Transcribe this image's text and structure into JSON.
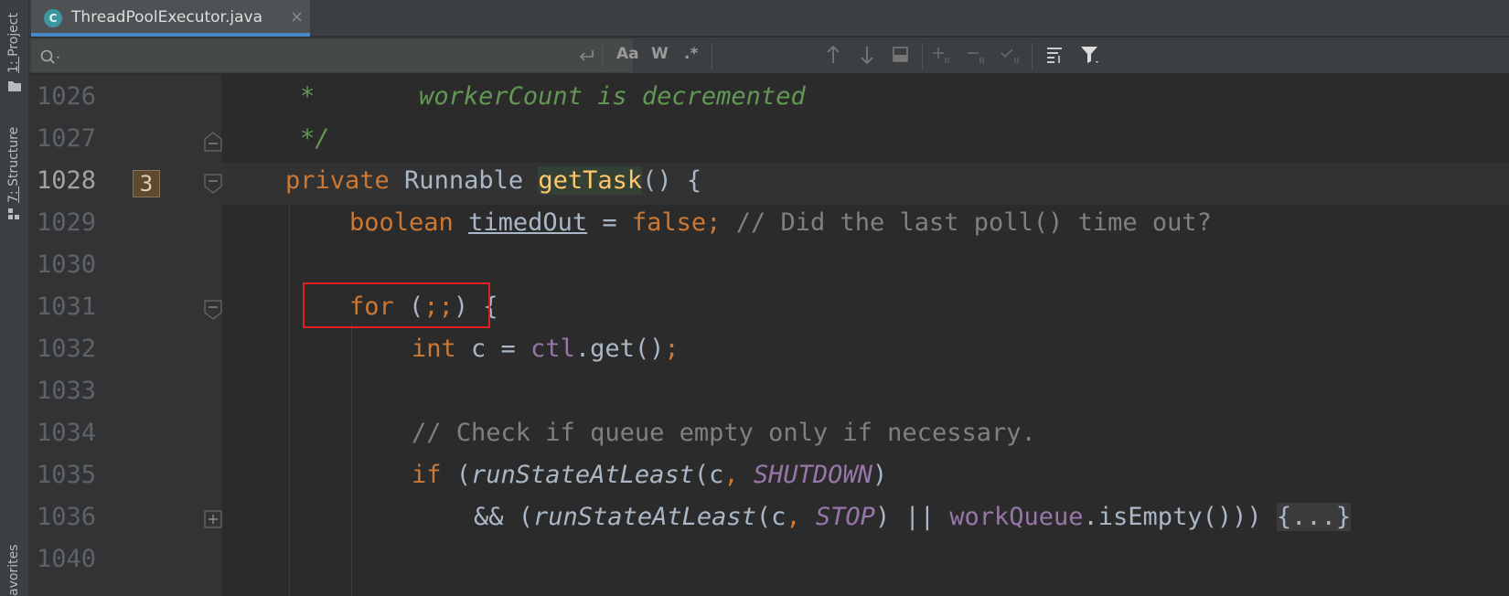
{
  "left_strip": {
    "project_label_prefix": "1: ",
    "project_label": "Project",
    "structure_label_prefix": "7: ",
    "structure_label": "Structure",
    "favorites_label": "avorites"
  },
  "tab": {
    "icon_letter": "C",
    "title": "ThreadPoolExecutor.java",
    "close": "×"
  },
  "search": {
    "placeholder": "",
    "match_case": "Aa",
    "words": "W",
    "regex": ".*"
  },
  "badge": "3",
  "lines": [
    {
      "num": "1026"
    },
    {
      "num": "1027"
    },
    {
      "num": "1028"
    },
    {
      "num": "1029"
    },
    {
      "num": "1030"
    },
    {
      "num": "1031"
    },
    {
      "num": "1032"
    },
    {
      "num": "1033"
    },
    {
      "num": "1034"
    },
    {
      "num": "1035"
    },
    {
      "num": "1036"
    },
    {
      "num": "1040"
    }
  ],
  "code": {
    "l1026_star": "*",
    "l1026_text": "workerCount is decremented",
    "l1027": "*/",
    "l1028_private": "private",
    "l1028_runnable": " Runnable ",
    "l1028_fn": "getTask",
    "l1028_rest": "() {",
    "l1029_boolean": "boolean",
    "l1029_var": "timedOut",
    "l1029_eq": " = ",
    "l1029_false": "false",
    "l1029_semi": ";",
    "l1029_comment": " // Did the last poll() time out?",
    "l1031_for": "for",
    "l1031_paren_open": " (",
    "l1031_semis": ";;",
    "l1031_rest": ") {",
    "l1032_int": "int",
    "l1032_c": " c = ",
    "l1032_ctl": "ctl",
    "l1032_get": ".get()",
    "l1032_semi": ";",
    "l1034_comment": "// Check if queue empty only if necessary.",
    "l1035_if": "if",
    "l1035_open": " (",
    "l1035_fn": "runStateAtLeast",
    "l1035_c": "(c",
    "l1035_comma": ", ",
    "l1035_const": "SHUTDOWN",
    "l1035_close": ")",
    "l1036_and": "&& (",
    "l1036_fn": "runStateAtLeast",
    "l1036_c": "(c",
    "l1036_comma": ", ",
    "l1036_const": "STOP",
    "l1036_or": ") || ",
    "l1036_wq": "workQueue",
    "l1036_isEmpty": ".isEmpty())) ",
    "l1036_fold": "{...}"
  }
}
